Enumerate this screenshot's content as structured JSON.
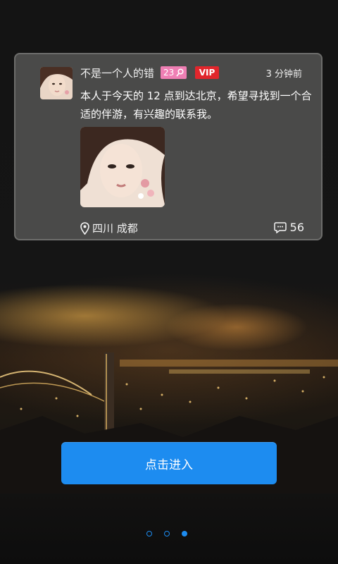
{
  "post": {
    "username": "不是一个人的错",
    "age": "23",
    "vip_label": "VIP",
    "time": "3 分钟前",
    "text": "本人于今天的 12 点到达北京，希望寻找到一个合适的伴游，有兴趣的联系我。",
    "location": "四川  成都",
    "comment_count": "56"
  },
  "enter_button_label": "点击进入",
  "pager": {
    "total": 3,
    "active_index": 2
  },
  "colors": {
    "accent": "#1d8cf0",
    "card_bg": "#4a4a49",
    "age_badge": "#ef7fb4",
    "vip_badge": "#e1262c"
  },
  "icons": {
    "age_gender": "female-symbol-icon",
    "location": "location-pin-icon",
    "comments": "comment-bubble-icon"
  }
}
